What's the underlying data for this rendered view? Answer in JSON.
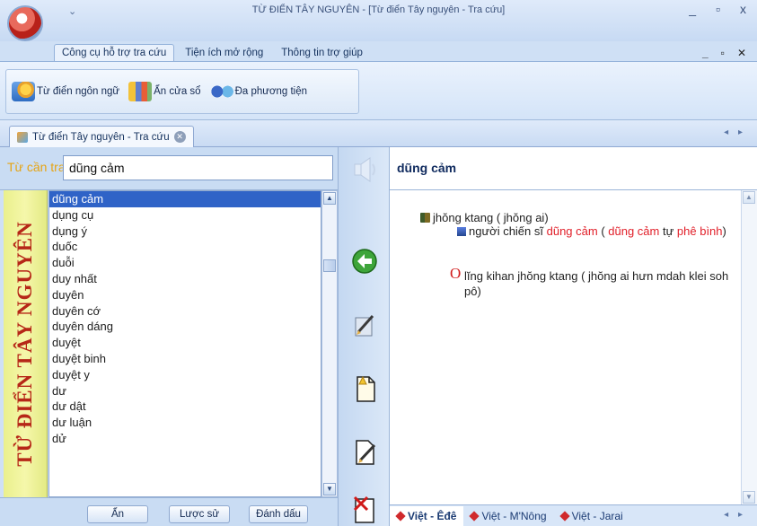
{
  "window": {
    "title": "TỪ ĐIỂN TÂY NGUYÊN - [Từ điển Tây nguyên - Tra cứu]",
    "quick_access": "⌄",
    "controls": [
      "_",
      "▫",
      "x"
    ],
    "mdi_controls": [
      "_",
      "▫",
      "✕"
    ]
  },
  "ribbon": {
    "tabs": [
      {
        "label": "Công cụ hỗ trợ tra cứu",
        "active": true
      },
      {
        "label": "Tiện ích mở rộng",
        "active": false
      },
      {
        "label": "Thông tin trợ giúp",
        "active": false
      }
    ],
    "buttons": [
      {
        "label": "Từ điển ngôn ngữ",
        "icon": "dictionary-icon"
      },
      {
        "label": "Ẩn cửa sổ",
        "icon": "hide-window-icon"
      },
      {
        "label": "Đa phương tiện",
        "icon": "multimedia-icon"
      }
    ]
  },
  "document_tab": {
    "label": "Từ điển Tây nguyên - Tra cứu",
    "close": "✕",
    "scroll": "◂ ▸"
  },
  "search": {
    "label": "Từ cần tra:",
    "value": "dũng cảm"
  },
  "banner": "TỪ ĐIỂN TÂY NGUYÊN",
  "word_list": {
    "selected_index": 0,
    "items": [
      "dũng cảm",
      "dụng cụ",
      "dụng ý",
      "duốc",
      "duỗi",
      "duy nhất",
      "duyên",
      "duyên cớ",
      "duyên dáng",
      "duyệt",
      "duyệt binh",
      "duyệt y",
      "dư",
      "dư dật",
      "dư luận",
      "dử"
    ]
  },
  "scrollbar": {
    "up": "▲",
    "down": "▼"
  },
  "left_buttons": [
    {
      "label": "Ẩn"
    },
    {
      "label": "Lược sử"
    },
    {
      "label": "Đánh dấu"
    }
  ],
  "middle_tools": [
    "speaker-icon",
    "back-arrow-icon",
    "edit-icon",
    "add-note-icon",
    "edit-note-icon",
    "delete-note-icon"
  ],
  "entry": {
    "headword": "dũng cảm",
    "translation": "jhŏng ktang ( jhŏng ai)",
    "definition_parts": [
      {
        "text": "người chiến sĩ ",
        "highlight": false
      },
      {
        "text": "dũng cảm",
        "highlight": true
      },
      {
        "text": " ( ",
        "highlight": false
      },
      {
        "text": "dũng cảm",
        "highlight": true
      },
      {
        "text": " tự ",
        "highlight": false
      },
      {
        "text": "phê bình",
        "highlight": true
      },
      {
        "text": ")",
        "highlight": false
      }
    ],
    "example_mark": "O",
    "example": "lĭng kihan jhŏng ktang ( jhŏng ai hưn mdah klei soh pô)"
  },
  "lang_tabs": [
    {
      "label": "Việt - Êđê",
      "active": true
    },
    {
      "label": "Việt - M'Nông",
      "active": false
    },
    {
      "label": "Việt - Jarai",
      "active": false
    }
  ],
  "lang_scroll": "◂ ▸",
  "colors": {
    "accent_blue": "#2f63c7",
    "banner_red": "#b62717",
    "highlight_red": "#e1202a",
    "label_orange": "#e6a413"
  }
}
